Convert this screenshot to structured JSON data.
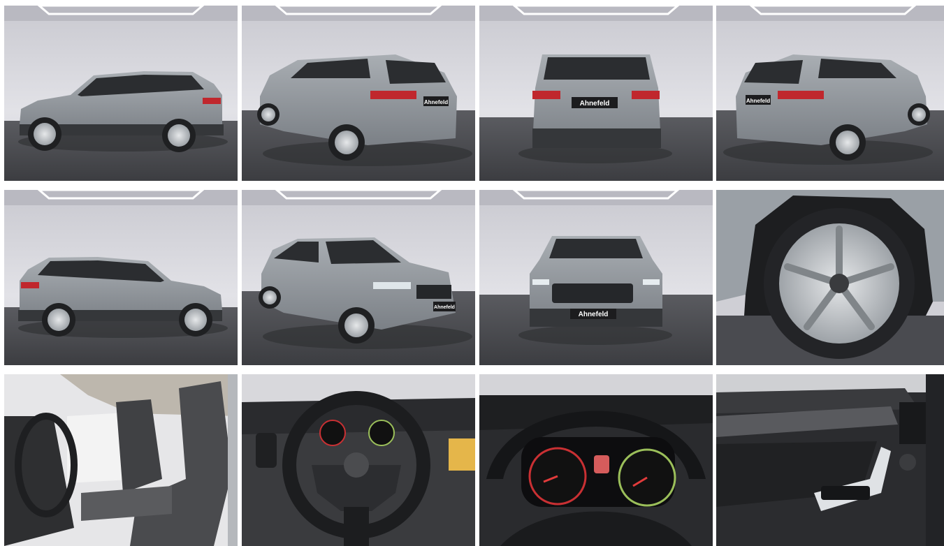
{
  "gallery": {
    "dealer_plate": "Ahnefeld",
    "colors": {
      "studio_wall": "#dcdce2",
      "studio_floor": "#4e4f53",
      "car_body": "#8f959b",
      "car_dark": "#2b2d30",
      "taillight": "#c0272d",
      "interior": "#3b3c3f"
    },
    "photos": [
      {
        "view": "side-left"
      },
      {
        "view": "rear-three-quarter-left"
      },
      {
        "view": "rear"
      },
      {
        "view": "rear-three-quarter-right"
      },
      {
        "view": "side-right"
      },
      {
        "view": "front-three-quarter-left"
      },
      {
        "view": "front"
      },
      {
        "view": "wheel-closeup"
      },
      {
        "view": "front-seats"
      },
      {
        "view": "steering-wheel"
      },
      {
        "view": "instrument-cluster"
      },
      {
        "view": "door-panel"
      }
    ]
  }
}
